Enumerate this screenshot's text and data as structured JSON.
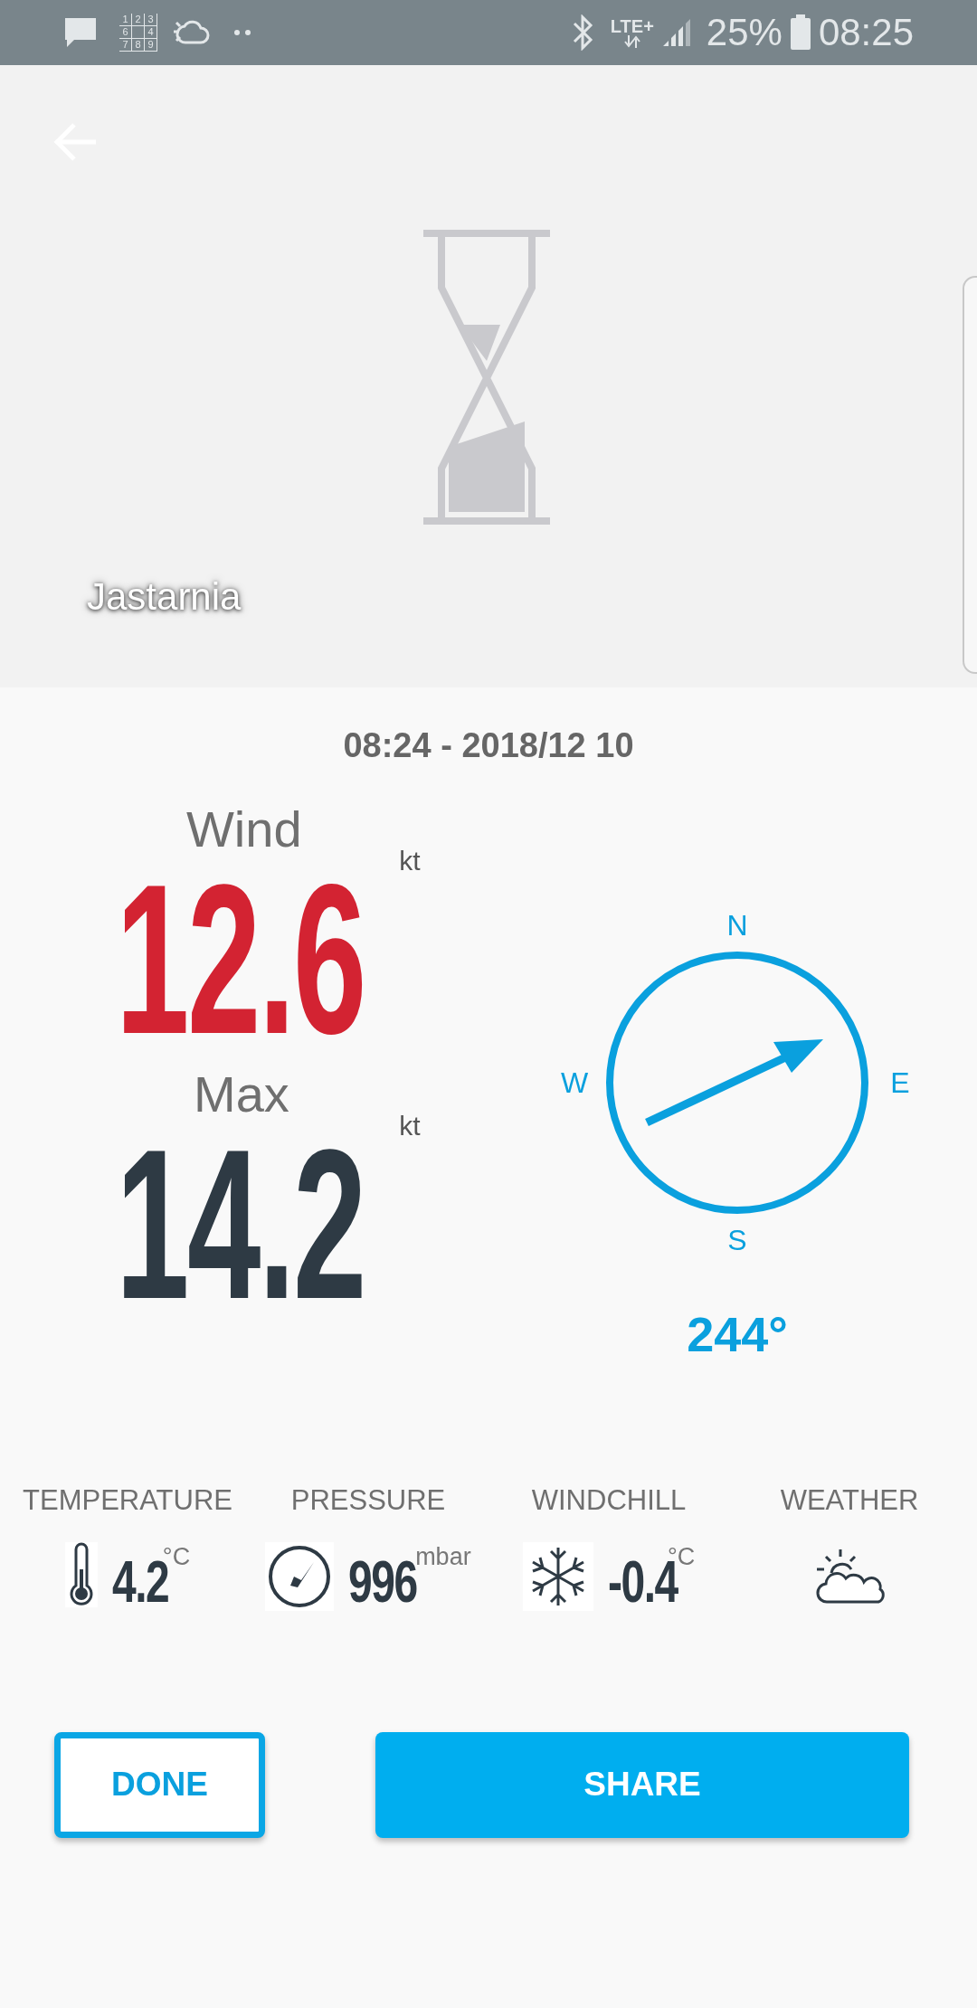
{
  "status_bar": {
    "grid_digits": [
      "1",
      "2",
      "3",
      "6",
      "4",
      "7",
      "8",
      "9"
    ],
    "network": "LTE+",
    "battery": "25%",
    "time": "08:25"
  },
  "header": {
    "location": "Jastarnia"
  },
  "timestamp": "08:24 - 2018/12 10",
  "readings": [
    {
      "kind": "wind",
      "label": "Wind",
      "value": "12.6",
      "unit": "kt"
    },
    {
      "kind": "max",
      "label": "Max",
      "value": "14.2",
      "unit": "kt"
    }
  ],
  "compass": {
    "north": "N",
    "east": "E",
    "south": "S",
    "west": "W",
    "direction": "244°"
  },
  "measures": [
    {
      "kind": "temperature",
      "label": "TEMPERATURE",
      "value": "4.2",
      "unit": "°C"
    },
    {
      "kind": "pressure",
      "label": "PRESSURE",
      "value": "996",
      "unit": "mbar"
    },
    {
      "kind": "windchill",
      "label": "WINDCHILL",
      "value": "-0.4",
      "unit": "°C"
    },
    {
      "kind": "weather",
      "label": "WEATHER"
    }
  ],
  "buttons": [
    {
      "kind": "outline",
      "label": "DONE"
    },
    {
      "kind": "filled",
      "label": "SHARE"
    }
  ]
}
